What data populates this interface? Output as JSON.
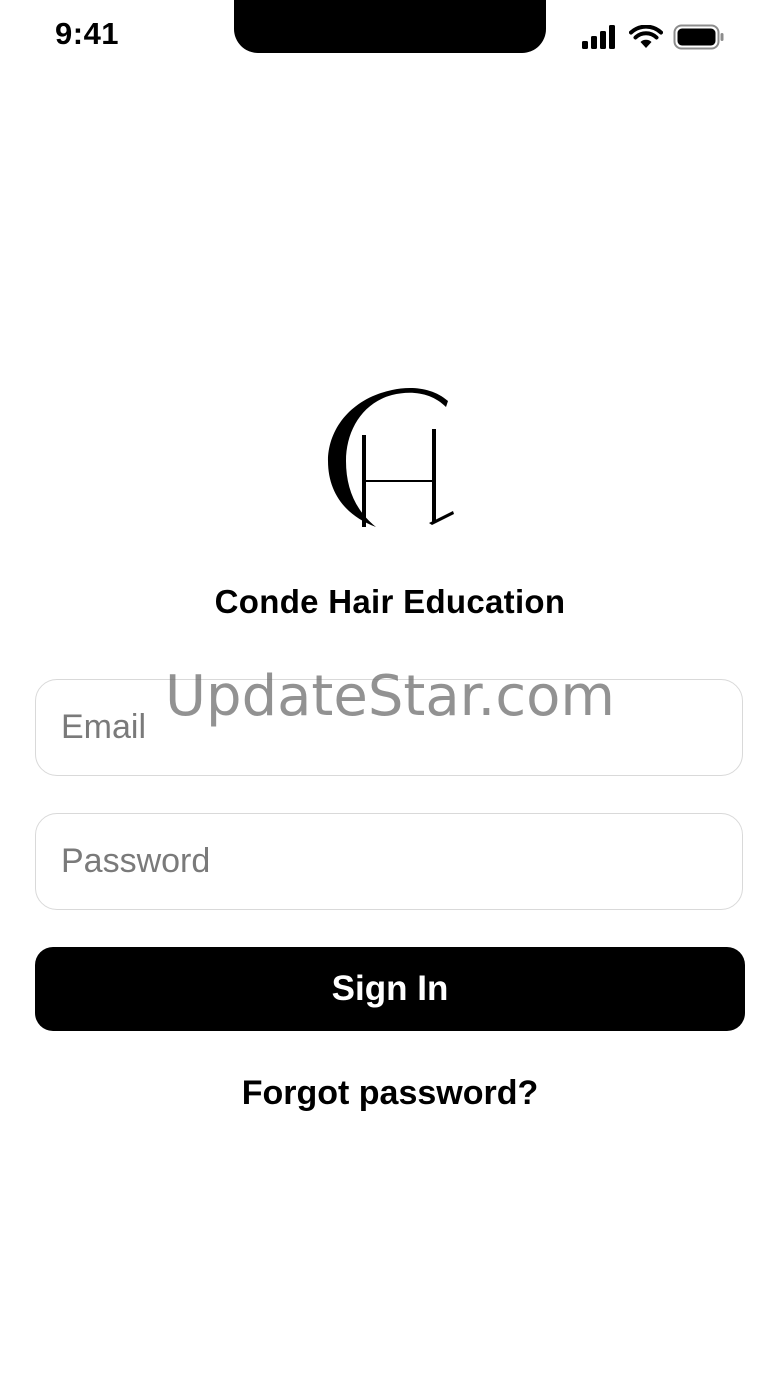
{
  "status_bar": {
    "time": "9:41",
    "icons": [
      "cellular-signal-icon",
      "wifi-icon",
      "battery-icon"
    ]
  },
  "brand": {
    "logo_icon": "ch-monogram-logo",
    "app_name": "Conde Hair Education"
  },
  "form": {
    "email": {
      "value": "",
      "placeholder": "Email"
    },
    "password": {
      "value": "",
      "placeholder": "Password"
    },
    "sign_in_label": "Sign In",
    "forgot_password_label": "Forgot password?"
  },
  "watermark": "UpdateStar.com",
  "colors": {
    "background": "#ffffff",
    "primary": "#000000",
    "button_text": "#ffffff",
    "field_border": "#d9d9d9",
    "placeholder": "#7a7a7a"
  }
}
